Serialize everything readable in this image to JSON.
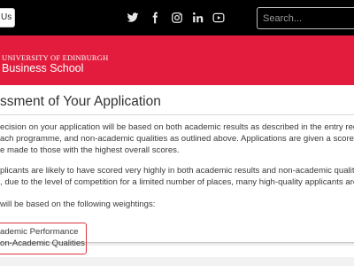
{
  "topbar": {
    "contact_label": "Us",
    "social": [
      "twitter-icon",
      "facebook-icon",
      "instagram-icon",
      "linkedin-icon",
      "youtube-icon"
    ],
    "search_placeholder": "Search..."
  },
  "banner": {
    "color": "#e31c3d",
    "logo_line1": "UNIVERSITY OF EDINBURGH",
    "logo_line2": "Business School"
  },
  "main": {
    "heading": "ssment of Your Application",
    "para1_line1": "ecision on your application will be based on both academic results as described in the entry requ",
    "para1_line2": "ach programme, and non-academic qualities as outlined above. Applications are given a score in",
    "para1_line3": "e made to those with the highest overall scores.",
    "para2_line1": "plicants are likely to have scored very highly in both academic results and non-academic qualities",
    "para2_line2": ", due to the level of competition for a limited number of places, many high-quality applicants are c",
    "para3": "will be based on the following weightings:",
    "list": [
      "ademic Performance",
      "on-Academic Qualities"
    ]
  }
}
